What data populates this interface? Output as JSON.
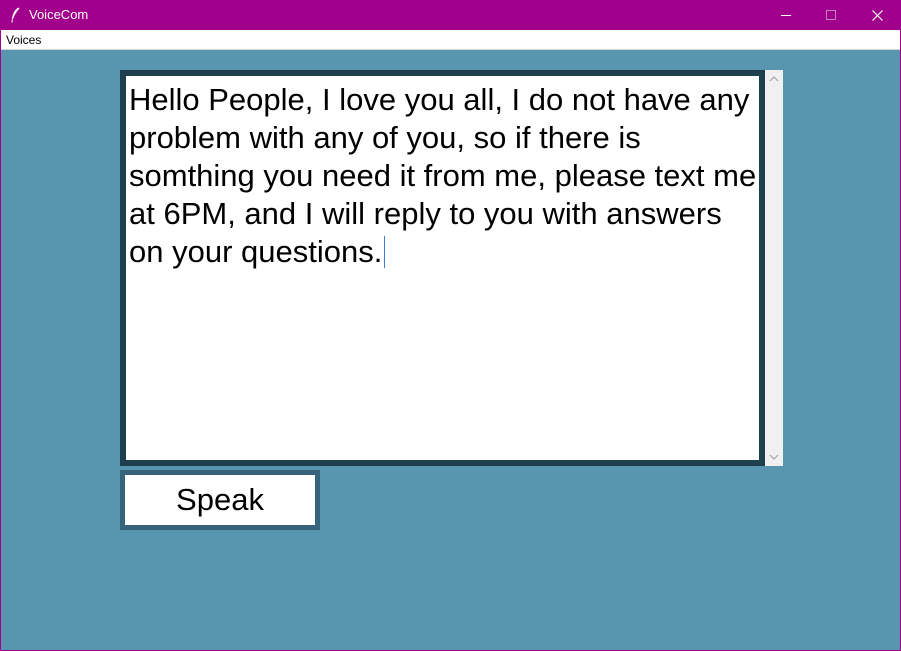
{
  "window": {
    "title": "VoiceCom",
    "icon": "feather-icon",
    "controls": [
      "minimize-icon",
      "maximize-icon",
      "close-icon"
    ]
  },
  "menu": {
    "items": [
      {
        "label": "Voices"
      }
    ]
  },
  "editor": {
    "text": "Hello People, I love you all, I do not have any problem with any of you, so if there is somthing you need it from me, please text me at 6PM, and I will reply to you with answers on your questions."
  },
  "speak_button": {
    "label": "Speak"
  },
  "colors": {
    "titlebar": "#a0008c",
    "background": "#5895ae",
    "text_border": "#1e3f4e",
    "button_border": "#36647a"
  }
}
